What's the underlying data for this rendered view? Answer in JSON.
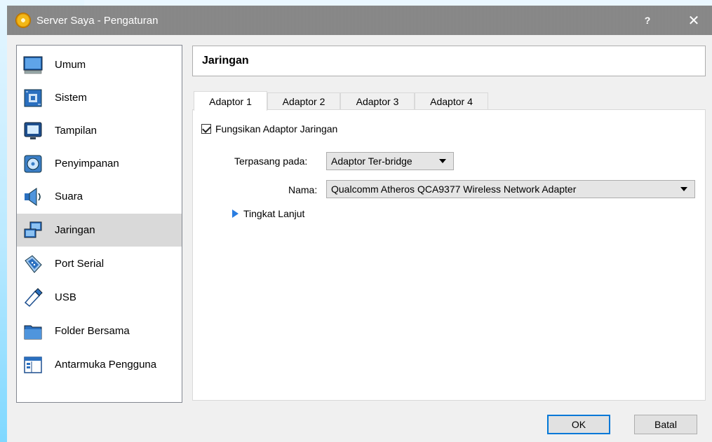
{
  "window": {
    "title": "Server Saya - Pengaturan",
    "help_label": "?",
    "close_label": "✕"
  },
  "sidebar": {
    "items": [
      {
        "label": "Umum",
        "icon": "monitor-icon"
      },
      {
        "label": "Sistem",
        "icon": "motherboard-icon"
      },
      {
        "label": "Tampilan",
        "icon": "display-icon"
      },
      {
        "label": "Penyimpanan",
        "icon": "storage-icon"
      },
      {
        "label": "Suara",
        "icon": "speaker-icon"
      },
      {
        "label": "Jaringan",
        "icon": "network-icon",
        "selected": true
      },
      {
        "label": "Port Serial",
        "icon": "serial-port-icon"
      },
      {
        "label": "USB",
        "icon": "usb-icon"
      },
      {
        "label": "Folder Bersama",
        "icon": "folder-icon"
      },
      {
        "label": "Antarmuka Pengguna",
        "icon": "user-interface-icon"
      }
    ]
  },
  "main": {
    "header_title": "Jaringan",
    "tabs": [
      {
        "label": "Adaptor 1",
        "active": true
      },
      {
        "label": "Adaptor 2"
      },
      {
        "label": "Adaptor 3"
      },
      {
        "label": "Adaptor 4"
      }
    ],
    "enable_checkbox": {
      "label": "Fungsikan Adaptor Jaringan",
      "checked": true
    },
    "attached_label": "Terpasang pada:",
    "attached_value": "Adaptor Ter-bridge",
    "name_label": "Nama:",
    "name_value": "Qualcomm Atheros QCA9377 Wireless Network Adapter",
    "advanced_label": "Tingkat Lanjut"
  },
  "buttons": {
    "ok": "OK",
    "cancel": "Batal"
  },
  "colors": {
    "titlebar": "#8a8a8a",
    "selection": "#d9d9d9",
    "accent": "#0078d7",
    "advanced_arrow": "#2a7de1"
  }
}
